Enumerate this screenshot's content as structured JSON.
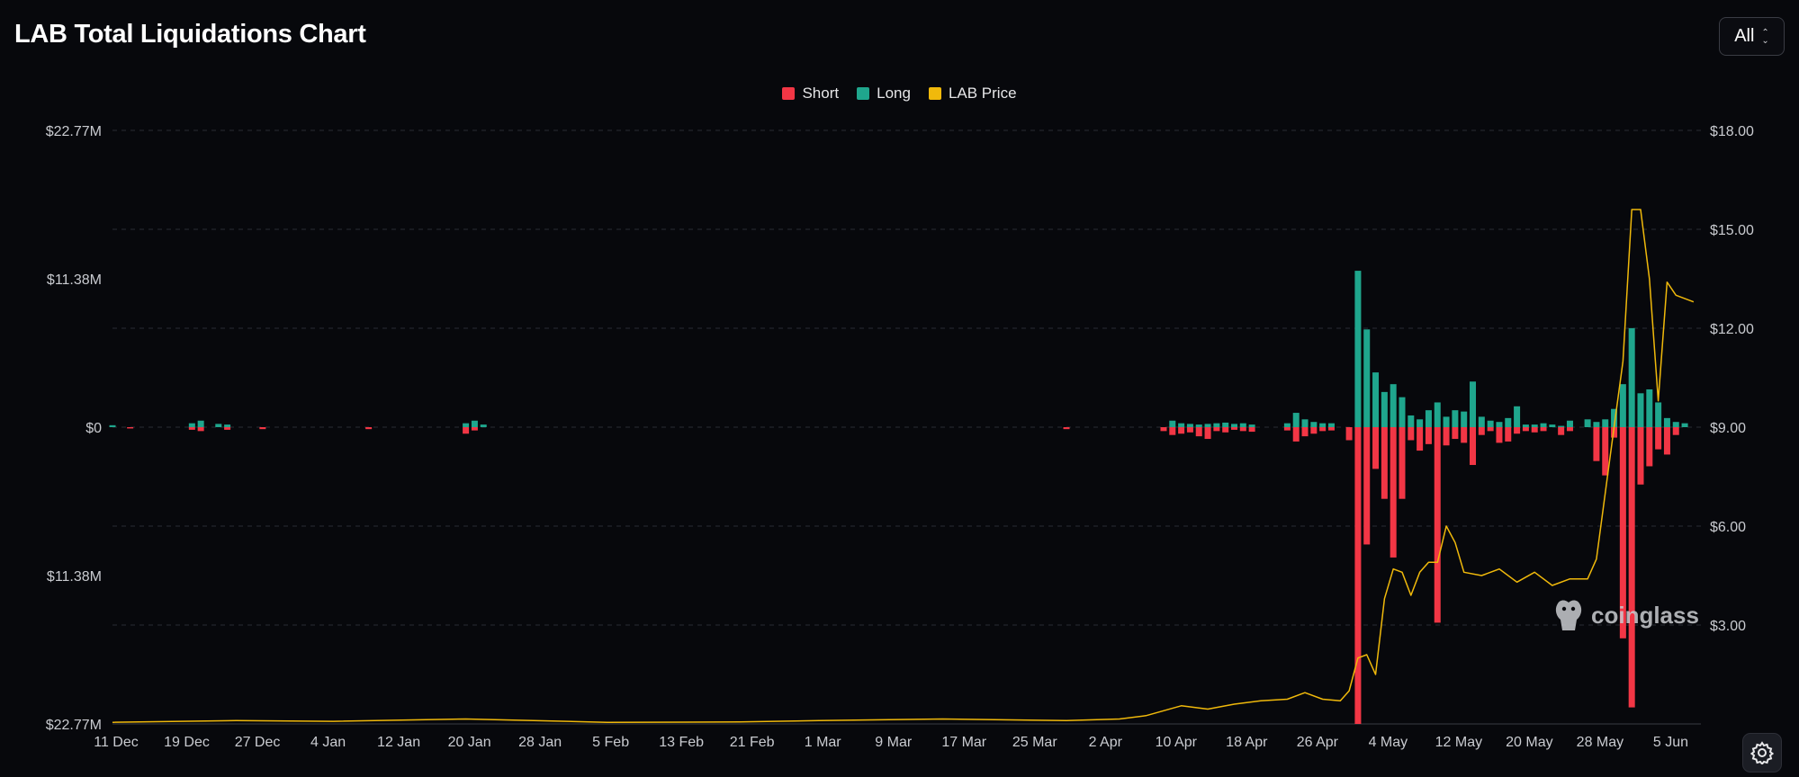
{
  "header": {
    "title": "LAB Total Liquidations Chart"
  },
  "range_selector": {
    "value": "All",
    "icon": "chevron-up-down-icon"
  },
  "watermark": {
    "text": "coinglass",
    "icon": "coinglass-logo-icon"
  },
  "settings": {
    "icon": "settings-gear-icon"
  },
  "colors": {
    "short": "#f23645",
    "long": "#1fa68d",
    "price": "#f0b90b",
    "background": "#07080c"
  },
  "chart_data": {
    "type": "bar",
    "title": "LAB Total Liquidations Chart",
    "legend": [
      "Short",
      "Long",
      "LAB Price"
    ],
    "legend_position": "top-center",
    "grid": true,
    "y_left": {
      "ticks": [
        "$22.77M",
        "$11.38M",
        "$0",
        "$11.38M",
        "$22.77M"
      ],
      "tick_values": [
        22.77,
        11.38,
        0,
        -11.38,
        -22.77
      ],
      "range": [
        -22.77,
        22.77
      ],
      "unit": "M USD"
    },
    "y_right": {
      "ticks": [
        "$18.00",
        "$15.00",
        "$12.00",
        "$9.00",
        "$6.00",
        "$3.00"
      ],
      "tick_values": [
        18,
        15,
        12,
        9,
        6,
        3
      ],
      "range": [
        0,
        18
      ]
    },
    "x_ticks": [
      "11 Dec",
      "19 Dec",
      "27 Dec",
      "4 Jan",
      "12 Jan",
      "20 Jan",
      "28 Jan",
      "5 Feb",
      "13 Feb",
      "21 Feb",
      "1 Mar",
      "9 Mar",
      "17 Mar",
      "25 Mar",
      "2 Apr",
      "10 Apr",
      "18 Apr",
      "26 Apr",
      "4 May",
      "12 May",
      "20 May",
      "28 May",
      "5 Jun"
    ],
    "x_start": "2024-12-11",
    "x_end": "2025-06-09",
    "series": [
      {
        "name": "Long",
        "kind": "bar",
        "values": [
          [
            "2024-12-11",
            0.15
          ],
          [
            "2024-12-20",
            0.3
          ],
          [
            "2024-12-21",
            0.5
          ],
          [
            "2024-12-23",
            0.25
          ],
          [
            "2024-12-24",
            0.2
          ],
          [
            "2025-01-20",
            0.3
          ],
          [
            "2025-01-21",
            0.5
          ],
          [
            "2025-01-22",
            0.2
          ],
          [
            "2025-04-10",
            0.5
          ],
          [
            "2025-04-11",
            0.3
          ],
          [
            "2025-04-12",
            0.25
          ],
          [
            "2025-04-13",
            0.2
          ],
          [
            "2025-04-14",
            0.25
          ],
          [
            "2025-04-15",
            0.3
          ],
          [
            "2025-04-16",
            0.35
          ],
          [
            "2025-04-17",
            0.25
          ],
          [
            "2025-04-18",
            0.3
          ],
          [
            "2025-04-19",
            0.2
          ],
          [
            "2025-04-23",
            0.3
          ],
          [
            "2025-04-24",
            1.1
          ],
          [
            "2025-04-25",
            0.6
          ],
          [
            "2025-04-26",
            0.4
          ],
          [
            "2025-04-27",
            0.3
          ],
          [
            "2025-04-28",
            0.3
          ],
          [
            "2025-05-01",
            12.0
          ],
          [
            "2025-05-02",
            7.5
          ],
          [
            "2025-05-03",
            4.2
          ],
          [
            "2025-05-04",
            2.7
          ],
          [
            "2025-05-05",
            3.3
          ],
          [
            "2025-05-06",
            2.3
          ],
          [
            "2025-05-07",
            0.9
          ],
          [
            "2025-05-08",
            0.6
          ],
          [
            "2025-05-09",
            1.3
          ],
          [
            "2025-05-10",
            1.9
          ],
          [
            "2025-05-11",
            0.8
          ],
          [
            "2025-05-12",
            1.3
          ],
          [
            "2025-05-13",
            1.2
          ],
          [
            "2025-05-14",
            3.5
          ],
          [
            "2025-05-15",
            0.8
          ],
          [
            "2025-05-16",
            0.5
          ],
          [
            "2025-05-17",
            0.4
          ],
          [
            "2025-05-18",
            0.7
          ],
          [
            "2025-05-19",
            1.6
          ],
          [
            "2025-05-20",
            0.2
          ],
          [
            "2025-05-21",
            0.2
          ],
          [
            "2025-05-22",
            0.3
          ],
          [
            "2025-05-23",
            0.2
          ],
          [
            "2025-05-24",
            0.1
          ],
          [
            "2025-05-25",
            0.5
          ],
          [
            "2025-05-27",
            0.6
          ],
          [
            "2025-05-28",
            0.4
          ],
          [
            "2025-05-29",
            0.6
          ],
          [
            "2025-05-30",
            1.4
          ],
          [
            "2025-05-31",
            3.3
          ],
          [
            "2025-06-01",
            7.6
          ],
          [
            "2025-06-02",
            2.6
          ],
          [
            "2025-06-03",
            2.9
          ],
          [
            "2025-06-04",
            1.9
          ],
          [
            "2025-06-05",
            0.7
          ],
          [
            "2025-06-06",
            0.4
          ],
          [
            "2025-06-07",
            0.3
          ]
        ]
      },
      {
        "name": "Short",
        "kind": "bar",
        "values": [
          [
            "2024-12-13",
            -0.1
          ],
          [
            "2024-12-20",
            -0.2
          ],
          [
            "2024-12-21",
            -0.3
          ],
          [
            "2024-12-24",
            -0.2
          ],
          [
            "2024-12-28",
            -0.15
          ],
          [
            "2025-01-09",
            -0.15
          ],
          [
            "2025-01-20",
            -0.5
          ],
          [
            "2025-01-21",
            -0.25
          ],
          [
            "2025-03-29",
            -0.15
          ],
          [
            "2025-04-09",
            -0.3
          ],
          [
            "2025-04-10",
            -0.6
          ],
          [
            "2025-04-11",
            -0.5
          ],
          [
            "2025-04-12",
            -0.4
          ],
          [
            "2025-04-13",
            -0.7
          ],
          [
            "2025-04-14",
            -0.9
          ],
          [
            "2025-04-15",
            -0.3
          ],
          [
            "2025-04-16",
            -0.4
          ],
          [
            "2025-04-17",
            -0.2
          ],
          [
            "2025-04-18",
            -0.3
          ],
          [
            "2025-04-19",
            -0.35
          ],
          [
            "2025-04-23",
            -0.25
          ],
          [
            "2025-04-24",
            -1.1
          ],
          [
            "2025-04-25",
            -0.7
          ],
          [
            "2025-04-26",
            -0.5
          ],
          [
            "2025-04-27",
            -0.3
          ],
          [
            "2025-04-28",
            -0.25
          ],
          [
            "2025-04-30",
            -1.0
          ],
          [
            "2025-05-01",
            -22.77
          ],
          [
            "2025-05-02",
            -9.0
          ],
          [
            "2025-05-03",
            -3.2
          ],
          [
            "2025-05-04",
            -5.5
          ],
          [
            "2025-05-05",
            -10.0
          ],
          [
            "2025-05-06",
            -5.5
          ],
          [
            "2025-05-07",
            -1.0
          ],
          [
            "2025-05-08",
            -1.8
          ],
          [
            "2025-05-09",
            -1.3
          ],
          [
            "2025-05-10",
            -15.0
          ],
          [
            "2025-05-11",
            -1.4
          ],
          [
            "2025-05-12",
            -0.9
          ],
          [
            "2025-05-13",
            -1.2
          ],
          [
            "2025-05-14",
            -2.9
          ],
          [
            "2025-05-15",
            -0.6
          ],
          [
            "2025-05-16",
            -0.3
          ],
          [
            "2025-05-17",
            -1.2
          ],
          [
            "2025-05-18",
            -1.1
          ],
          [
            "2025-05-19",
            -0.5
          ],
          [
            "2025-05-20",
            -0.3
          ],
          [
            "2025-05-21",
            -0.4
          ],
          [
            "2025-05-22",
            -0.3
          ],
          [
            "2025-05-24",
            -0.6
          ],
          [
            "2025-05-25",
            -0.3
          ],
          [
            "2025-05-28",
            -2.6
          ],
          [
            "2025-05-29",
            -3.7
          ],
          [
            "2025-05-30",
            -0.8
          ],
          [
            "2025-05-31",
            -16.2
          ],
          [
            "2025-06-01",
            -21.5
          ],
          [
            "2025-06-02",
            -4.4
          ],
          [
            "2025-06-03",
            -3.0
          ],
          [
            "2025-06-04",
            -1.7
          ],
          [
            "2025-06-05",
            -2.1
          ],
          [
            "2025-06-06",
            -0.6
          ]
        ]
      },
      {
        "name": "LAB Price",
        "kind": "line",
        "values": [
          [
            "2024-12-11",
            0.05
          ],
          [
            "2024-12-25",
            0.1
          ],
          [
            "2025-01-05",
            0.08
          ],
          [
            "2025-01-20",
            0.15
          ],
          [
            "2025-02-05",
            0.05
          ],
          [
            "2025-02-20",
            0.06
          ],
          [
            "2025-03-01",
            0.1
          ],
          [
            "2025-03-15",
            0.15
          ],
          [
            "2025-03-29",
            0.1
          ],
          [
            "2025-04-04",
            0.15
          ],
          [
            "2025-04-07",
            0.25
          ],
          [
            "2025-04-09",
            0.4
          ],
          [
            "2025-04-11",
            0.55
          ],
          [
            "2025-04-14",
            0.45
          ],
          [
            "2025-04-17",
            0.6
          ],
          [
            "2025-04-20",
            0.7
          ],
          [
            "2025-04-23",
            0.75
          ],
          [
            "2025-04-25",
            0.95
          ],
          [
            "2025-04-27",
            0.75
          ],
          [
            "2025-04-29",
            0.7
          ],
          [
            "2025-04-30",
            1.0
          ],
          [
            "2025-05-01",
            2.0
          ],
          [
            "2025-05-02",
            2.1
          ],
          [
            "2025-05-03",
            1.5
          ],
          [
            "2025-05-04",
            3.8
          ],
          [
            "2025-05-05",
            4.7
          ],
          [
            "2025-05-06",
            4.6
          ],
          [
            "2025-05-07",
            3.9
          ],
          [
            "2025-05-08",
            4.6
          ],
          [
            "2025-05-09",
            4.9
          ],
          [
            "2025-05-10",
            4.9
          ],
          [
            "2025-05-11",
            6.0
          ],
          [
            "2025-05-12",
            5.5
          ],
          [
            "2025-05-13",
            4.6
          ],
          [
            "2025-05-15",
            4.5
          ],
          [
            "2025-05-17",
            4.7
          ],
          [
            "2025-05-19",
            4.3
          ],
          [
            "2025-05-21",
            4.6
          ],
          [
            "2025-05-23",
            4.2
          ],
          [
            "2025-05-25",
            4.4
          ],
          [
            "2025-05-27",
            4.4
          ],
          [
            "2025-05-28",
            5.0
          ],
          [
            "2025-05-29",
            7.0
          ],
          [
            "2025-05-30",
            9.0
          ],
          [
            "2025-05-31",
            11.0
          ],
          [
            "2025-06-01",
            15.6
          ],
          [
            "2025-06-02",
            15.6
          ],
          [
            "2025-06-03",
            13.5
          ],
          [
            "2025-06-04",
            9.8
          ],
          [
            "2025-06-05",
            13.4
          ],
          [
            "2025-06-06",
            13.0
          ],
          [
            "2025-06-08",
            12.8
          ]
        ]
      }
    ]
  }
}
